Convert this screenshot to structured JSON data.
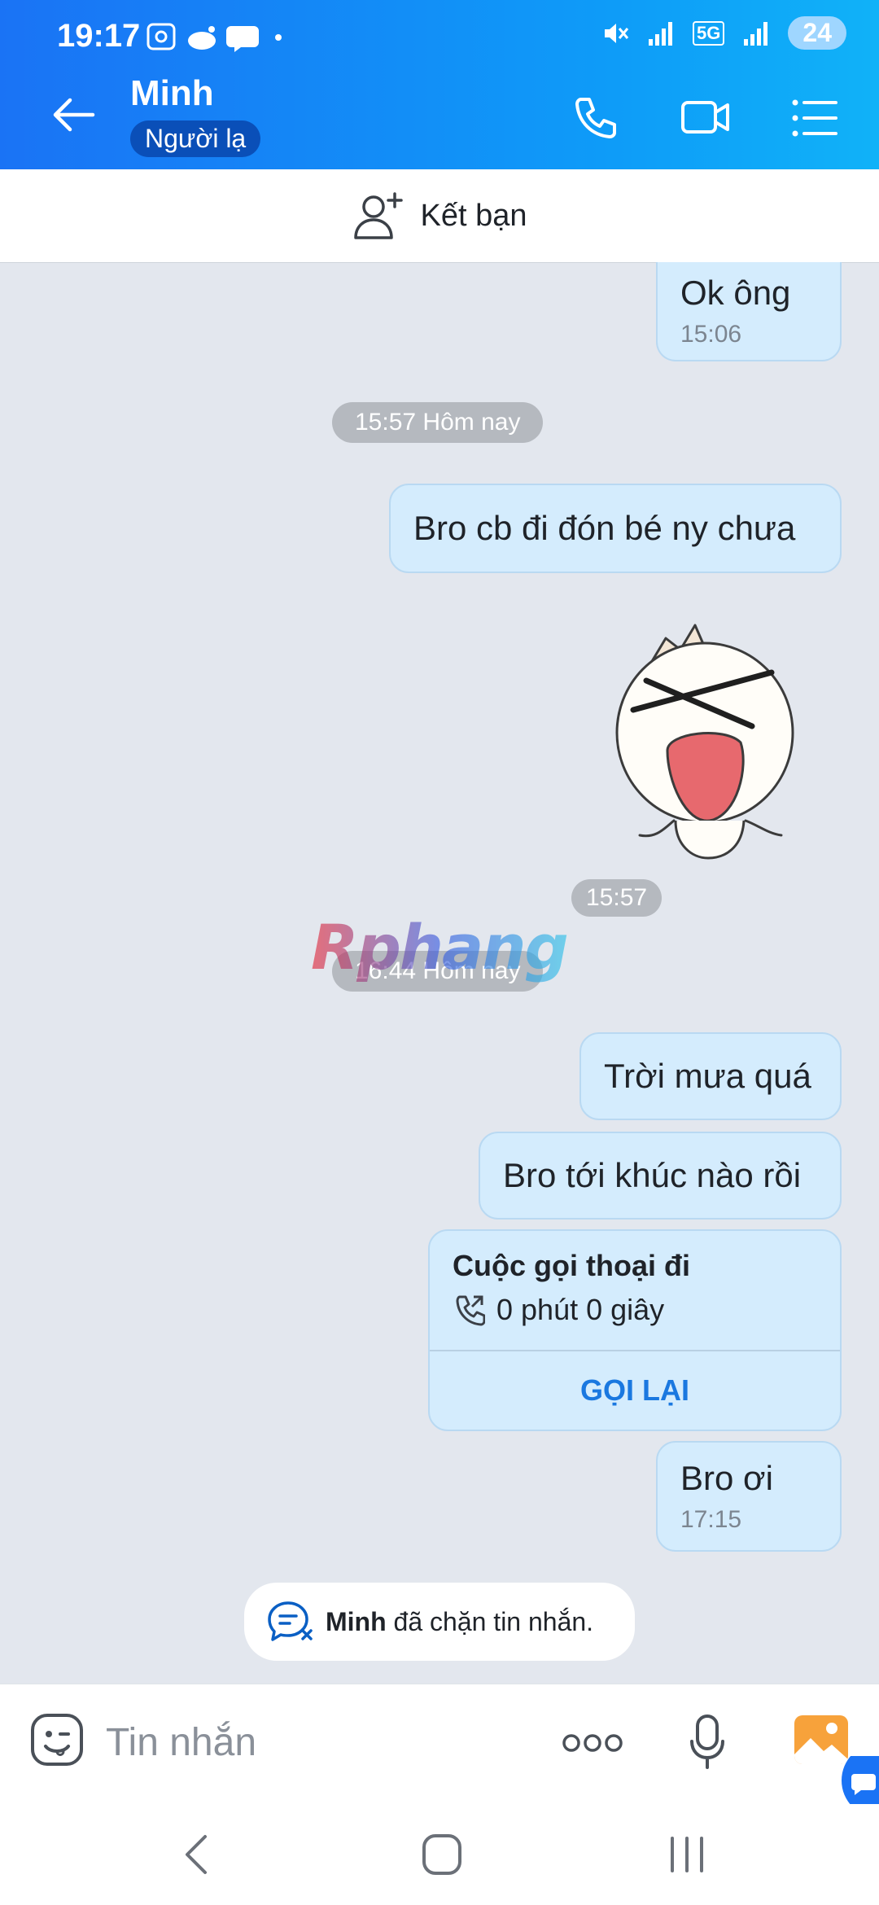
{
  "status_bar": {
    "time": "19:17",
    "battery": "24",
    "network": "5G"
  },
  "header": {
    "contact_name": "Minh",
    "stranger_badge": "Người lạ"
  },
  "add_friend": {
    "label": "Kết bạn"
  },
  "messages": [
    {
      "text": "Ok ông",
      "time": "15:06"
    },
    {
      "text": "Bro cb đi đón bé ny chưa"
    },
    {
      "text": "Trời mưa quá"
    },
    {
      "text": "Bro tới khúc nào rồi"
    },
    {
      "text": "Bro ơi",
      "time": "17:15"
    }
  ],
  "time_separators": {
    "first": "15:57 Hôm nay",
    "sticker_time": "15:57",
    "second": "16:44 Hôm nay"
  },
  "call_card": {
    "title": "Cuộc gọi thoại đi",
    "duration": "0 phút 0 giây",
    "callback_label": "GỌI LẠI"
  },
  "blocked_notice": {
    "name": "Minh",
    "text": "đã chặn tin nhắn."
  },
  "input": {
    "placeholder": "Tin nhắn"
  },
  "watermark": {
    "text": "Rphang"
  },
  "colors": {
    "header_gradient_start": "#1a73f5",
    "header_gradient_end": "#10b2f8",
    "bubble": "#d4ecfd",
    "callback": "#1a78e0",
    "chat_bg": "#e3e7ee"
  }
}
